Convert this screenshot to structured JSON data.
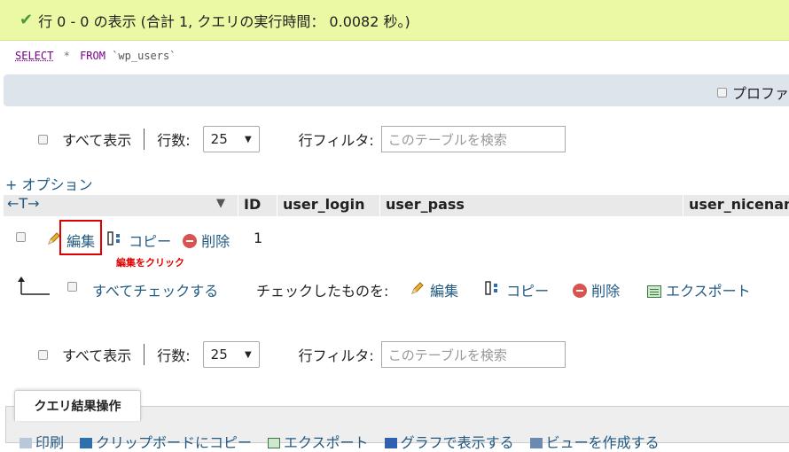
{
  "success": {
    "icon": "check-icon",
    "message": "行 0 - 0 の表示 (合計 1, クエリの実行時間： 0.0082 秒。)"
  },
  "sql": {
    "select": "SELECT",
    "star": "*",
    "from": "FROM",
    "table": "`wp_users`"
  },
  "profile_option": {
    "label": "プロファ"
  },
  "nav_top": {
    "show_all": "すべて表示",
    "rows_label": "行数:",
    "rows_value": "25",
    "filter_label": "行フィルタ:",
    "filter_placeholder": "このテーブルを検索"
  },
  "options_link": "+ オプション",
  "table": {
    "arrows": "←T→",
    "columns": [
      "ID",
      "user_login",
      "user_pass",
      "user_nicenam"
    ],
    "row": {
      "edit": "編集",
      "copy": "コピー",
      "delete": "削除",
      "id": "1"
    }
  },
  "annotation": "編集をクリック",
  "bulk": {
    "check_all": "すべてチェックする",
    "with_selected": "チェックしたものを:",
    "edit": "編集",
    "copy": "コピー",
    "delete": "削除",
    "export": "エクスポート"
  },
  "nav_bottom": {
    "show_all": "すべて表示",
    "rows_label": "行数:",
    "rows_value": "25",
    "filter_label": "行フィルタ:",
    "filter_placeholder": "このテーブルを検索"
  },
  "query_ops": {
    "title": "クエリ結果操作",
    "links": [
      "印刷",
      "クリップボードにコピー",
      "エクスポート",
      "グラフで表示する",
      "ビューを作成する"
    ]
  },
  "colors": {
    "success_bg": "#ebf8a4",
    "link": "#235a81",
    "annotation": "#e00000"
  }
}
